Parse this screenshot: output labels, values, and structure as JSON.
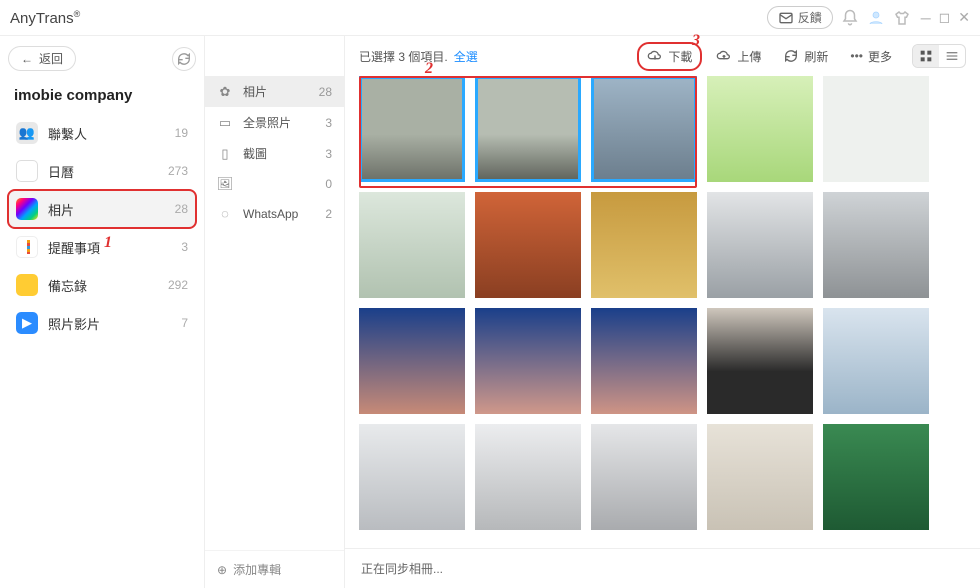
{
  "app": {
    "name": "AnyTrans",
    "reg_mark": "®"
  },
  "titlebar": {
    "feedback": "反饋"
  },
  "sidebar": {
    "back": "返回",
    "account": "imobie company",
    "items": [
      {
        "label": "聯繫人",
        "count": 19
      },
      {
        "label": "日曆",
        "count": 273
      },
      {
        "label": "相片",
        "count": 28
      },
      {
        "label": "提醒事項",
        "count": 3
      },
      {
        "label": "備忘錄",
        "count": 292
      },
      {
        "label": "照片影片",
        "count": 7
      }
    ]
  },
  "categories": {
    "items": [
      {
        "label": "相片",
        "count": 28
      },
      {
        "label": "全景照片",
        "count": 3
      },
      {
        "label": "截圖",
        "count": 3
      },
      {
        "label": "",
        "count": 0
      },
      {
        "label": "WhatsApp",
        "count": 2
      }
    ],
    "add": "添加專輯"
  },
  "toolbar": {
    "selection": "已選擇 3 個項目.",
    "select_all": "全選",
    "download": "下載",
    "upload": "上傳",
    "refresh": "刷新",
    "more": "更多"
  },
  "steps": {
    "one": "1",
    "two": "2",
    "three": "3"
  },
  "footer": {
    "status": "正在同步相冊..."
  },
  "colors": {
    "highlight": "#e03030",
    "select": "#2aa9ff"
  }
}
